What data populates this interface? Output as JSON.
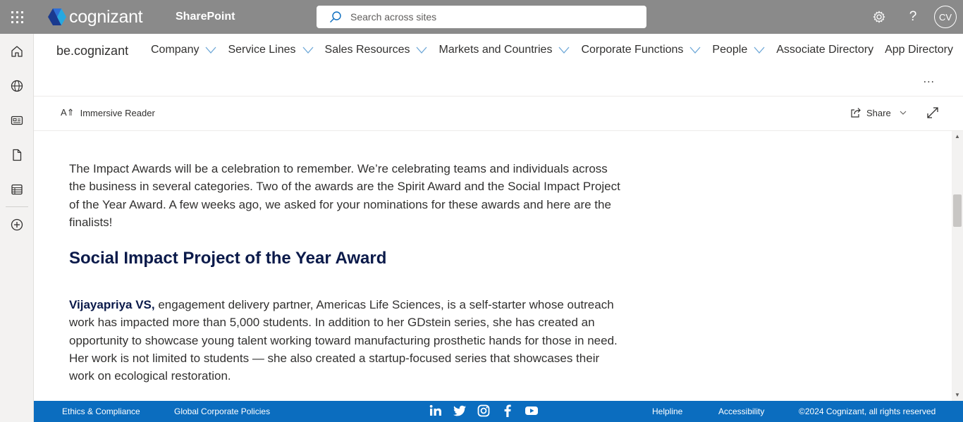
{
  "suitebar": {
    "brand": "cognizant",
    "app_name": "SharePoint",
    "search_placeholder": "Search across sites",
    "avatar_initials": "CV"
  },
  "hubnav": {
    "site_title": "be.cognizant",
    "items": [
      {
        "label": "Company",
        "has_dropdown": true
      },
      {
        "label": "Service Lines",
        "has_dropdown": true
      },
      {
        "label": "Sales Resources",
        "has_dropdown": true
      },
      {
        "label": "Markets and Countries",
        "has_dropdown": true
      },
      {
        "label": "Corporate Functions",
        "has_dropdown": true
      },
      {
        "label": "People",
        "has_dropdown": true
      },
      {
        "label": "Associate Directory",
        "has_dropdown": false
      },
      {
        "label": "App Directory",
        "has_dropdown": false
      }
    ],
    "more_label": "..."
  },
  "cmdbar": {
    "immersive_reader": "Immersive Reader",
    "share": "Share"
  },
  "article": {
    "intro": "The Impact Awards will be a celebration to remember. We’re celebrating teams and individuals across the business in several categories. Two of the awards are the Spirit Award and the Social Impact Project of the Year Award. A few weeks ago, we asked for your nominations for these awards and here are the finalists!",
    "heading": "Social Impact Project of the Year Award",
    "finalist_name": "Vijayapriya VS,",
    "finalist_text": " engagement delivery partner, Americas Life Sciences, is a self-starter whose outreach work has impacted more than 5,000 students. In addition to her GDstein series, she has created an opportunity to showcase young talent working toward manufacturing prosthetic hands for those in need. Her work is not limited to students — she also created a startup-focused series that showcases their work on ecological restoration."
  },
  "footer": {
    "ethics": "Ethics & Compliance",
    "policies": "Global Corporate Policies",
    "helpline": "Helpline",
    "accessibility": "Accessibility",
    "copyright": "©2024 Cognizant, all rights reserved",
    "social_icons": [
      "linkedin-icon",
      "twitter-icon",
      "instagram-icon",
      "facebook-icon",
      "youtube-icon"
    ]
  },
  "colors": {
    "suitebar_bg": "#8a8a8a",
    "footer_bg": "#0b6dbf",
    "heading": "#0b1a4a",
    "chevron": "#6ea8d8"
  }
}
